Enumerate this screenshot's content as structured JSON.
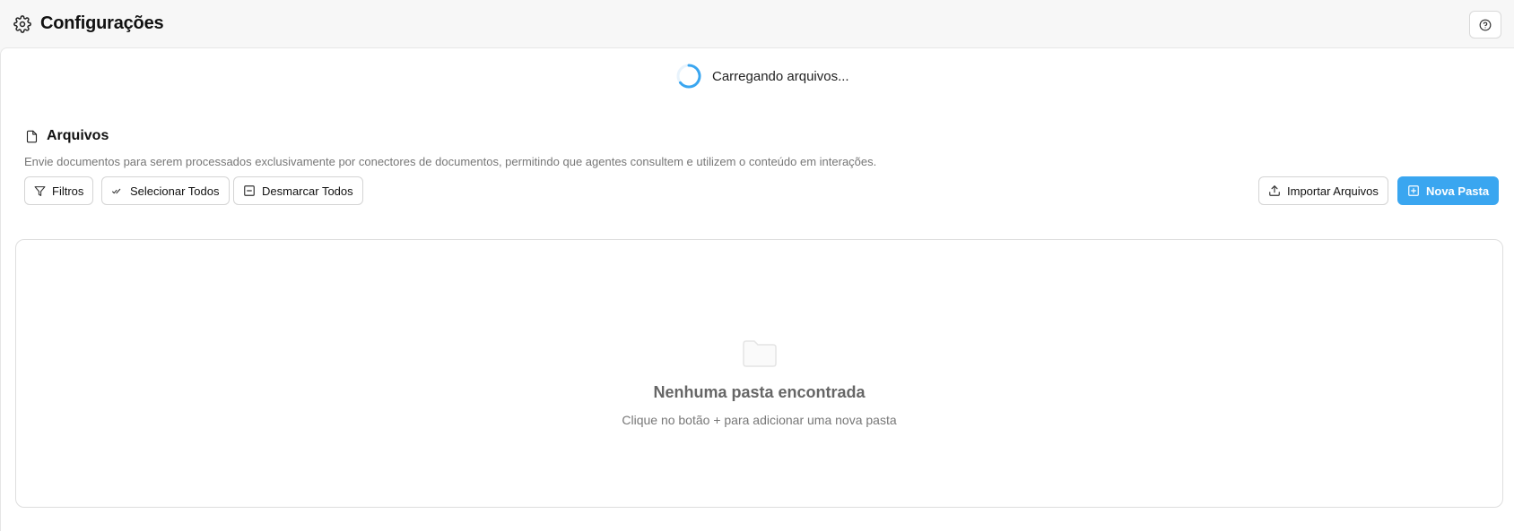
{
  "header": {
    "title": "Configurações",
    "icon": "gear-icon",
    "help_icon": "help-circle-icon"
  },
  "loading": {
    "text": "Carregando arquivos...",
    "icon": "spinner-icon",
    "accent": "#3aa6f0"
  },
  "section": {
    "title": "Arquivos",
    "icon": "file-icon",
    "description": "Envie documentos para serem processados exclusivamente por conectores de documentos, permitindo que agentes consultem e utilizem o conteúdo em interações."
  },
  "toolbar": {
    "filters_label": "Filtros",
    "select_all_label": "Selecionar Todos",
    "deselect_all_label": "Desmarcar Todos",
    "import_label": "Importar Arquivos",
    "new_folder_label": "Nova Pasta",
    "primary_color": "#3aa6f0"
  },
  "empty_state": {
    "icon": "folder-icon",
    "title": "Nenhuma pasta encontrada",
    "subtitle": "Clique no botão + para adicionar uma nova pasta"
  }
}
